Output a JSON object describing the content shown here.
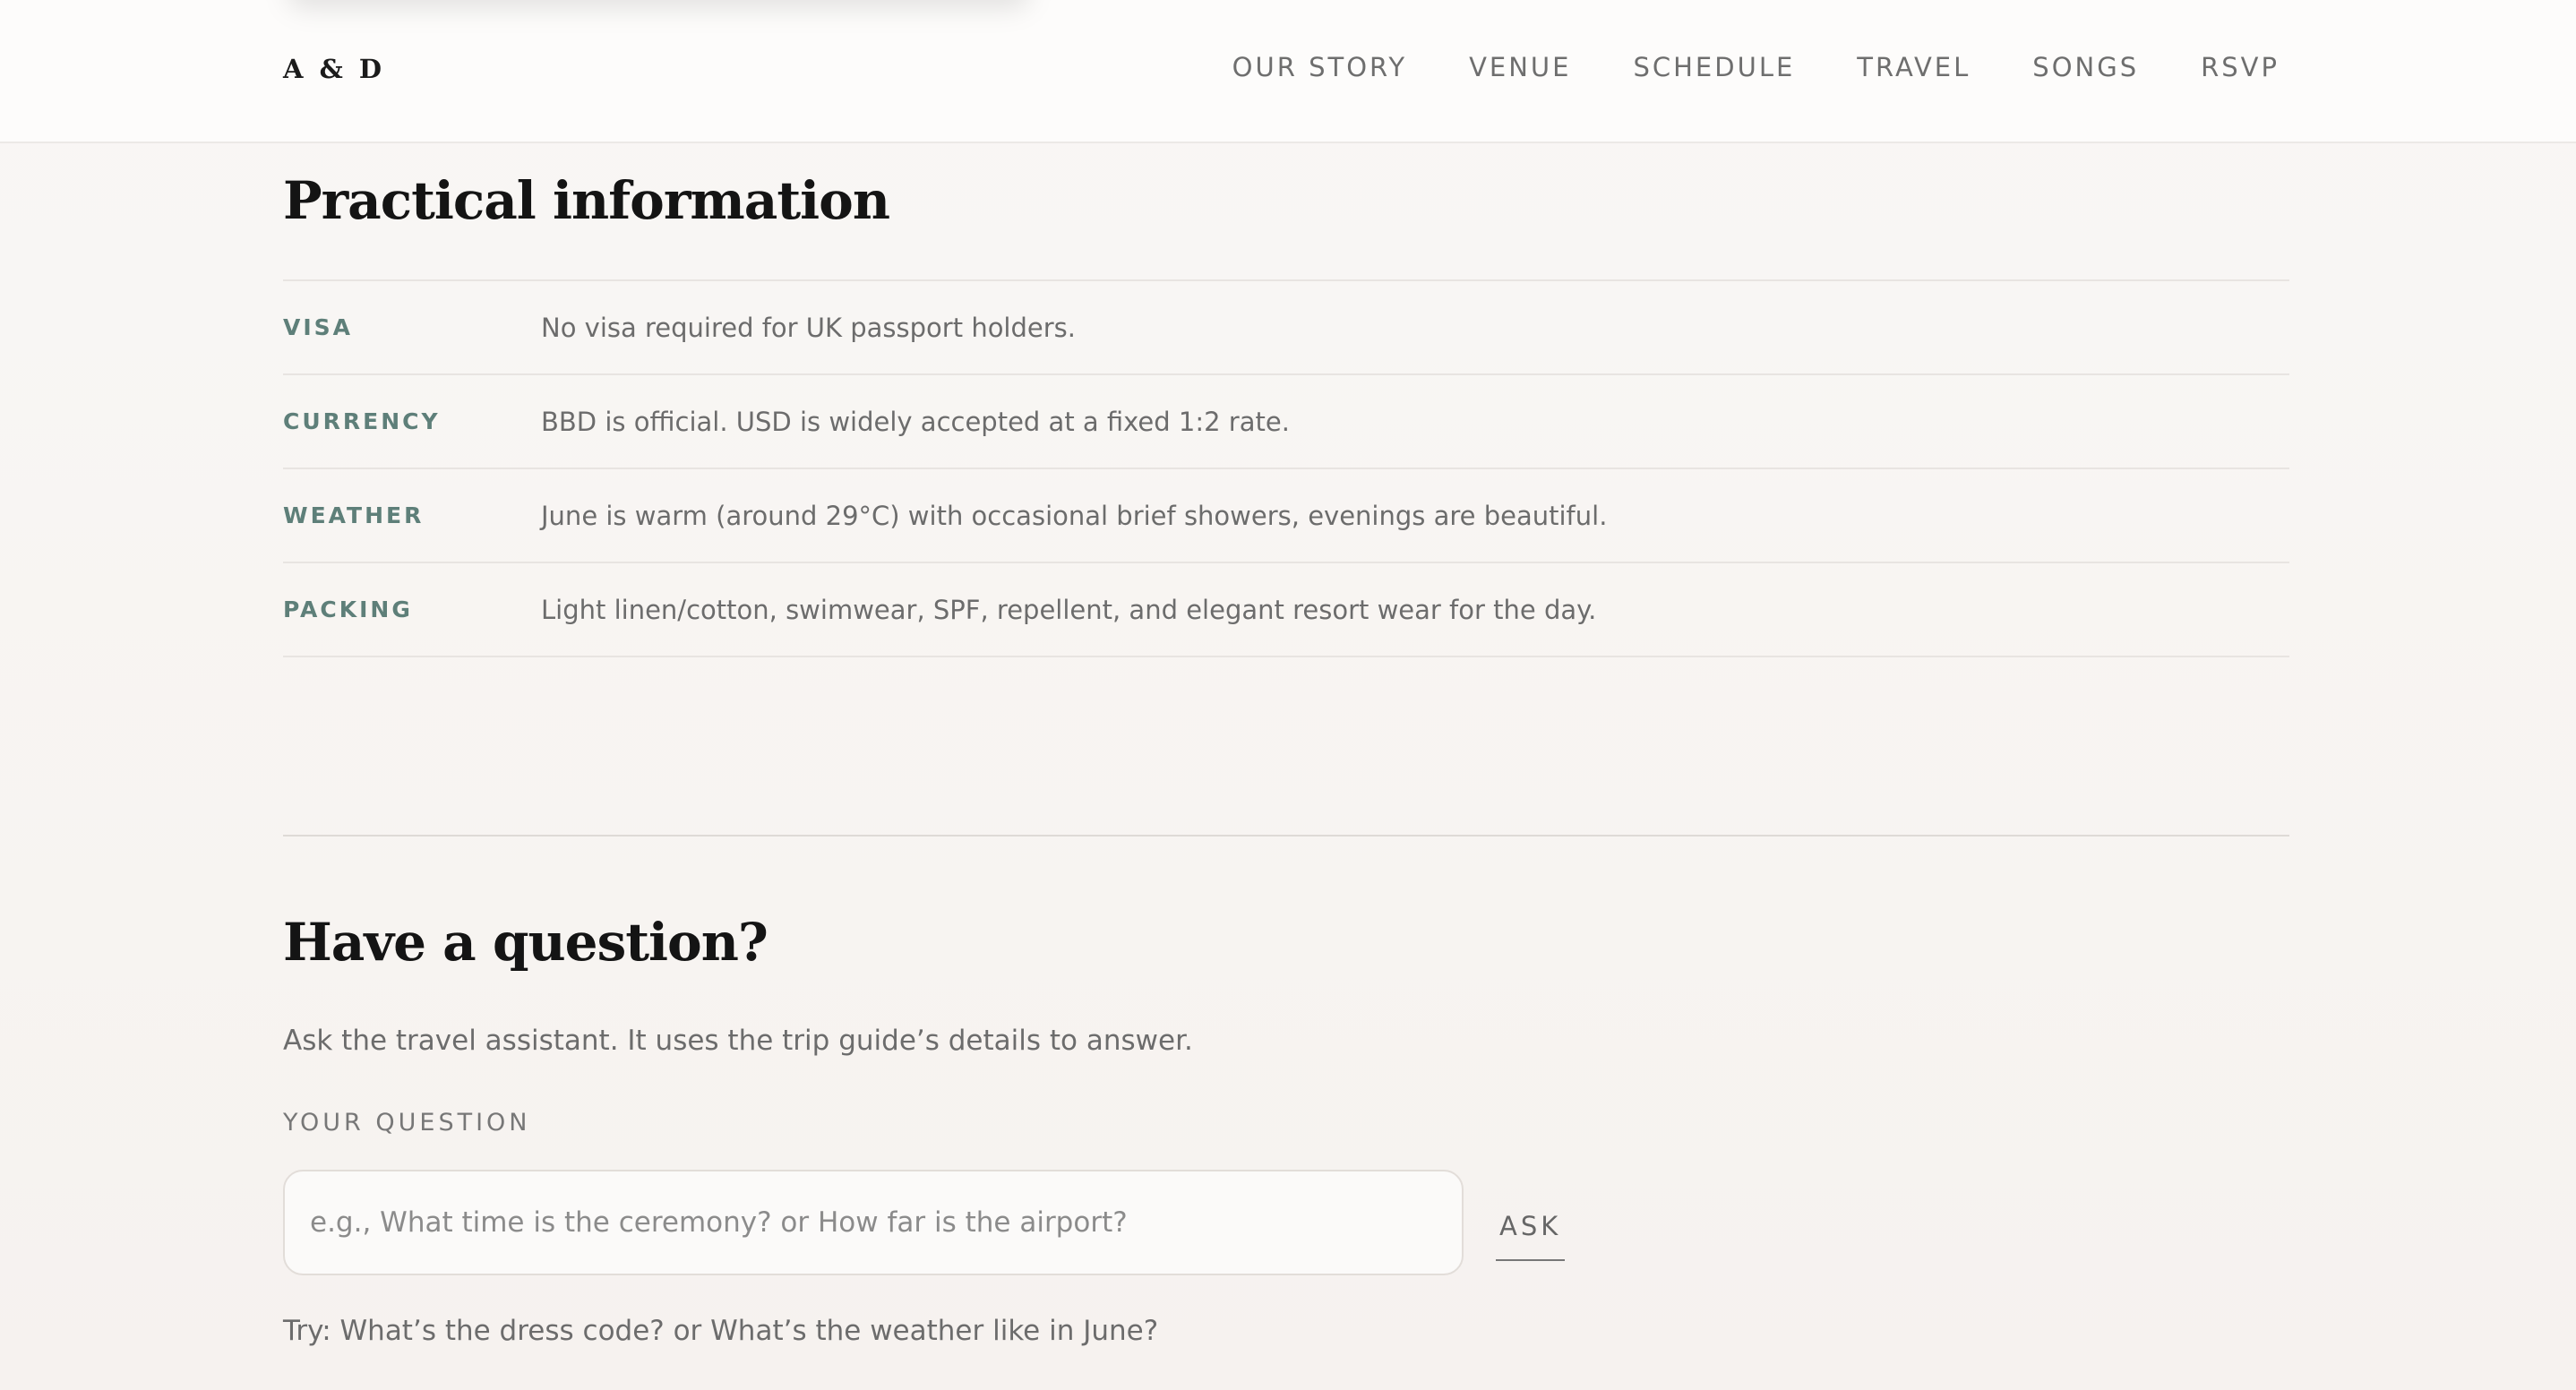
{
  "header": {
    "logo": "A & D",
    "nav": [
      "OUR STORY",
      "VENUE",
      "SCHEDULE",
      "TRAVEL",
      "SONGS",
      "RSVP"
    ]
  },
  "practical": {
    "title": "Practical information",
    "rows": [
      {
        "key": "VISA",
        "value": "No visa required for UK passport holders."
      },
      {
        "key": "CURRENCY",
        "value": "BBD is official. USD is widely accepted at a fixed 1:2 rate."
      },
      {
        "key": "WEATHER",
        "value": "June is warm (around 29°C) with occasional brief showers, evenings are beautiful."
      },
      {
        "key": "PACKING",
        "value": "Light linen/cotton, swimwear, SPF, repellent, and elegant resort wear for the day."
      }
    ]
  },
  "question": {
    "title": "Have a question?",
    "intro": "Ask the travel assistant. It uses the trip guide’s details to answer.",
    "label": "YOUR QUESTION",
    "placeholder": "e.g., What time is the ceremony? or How far is the airport?",
    "value": "",
    "ask_label": "ASK",
    "try_text": "Try: What’s the dress code? or What’s the weather like in June?"
  },
  "colors": {
    "accent": "#5e7f79",
    "heading": "#141414",
    "body": "#6c6c6c",
    "background": "#f7f4f1"
  }
}
